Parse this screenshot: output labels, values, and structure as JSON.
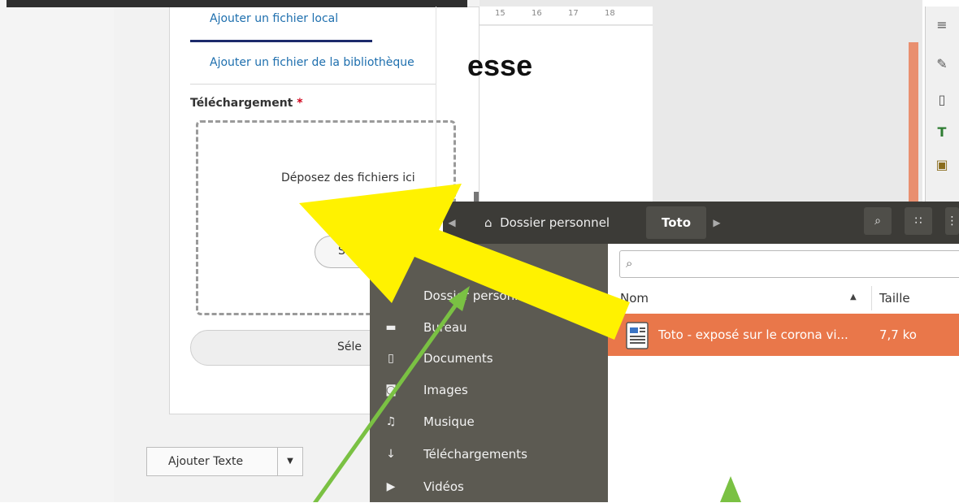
{
  "upload_form": {
    "tab_local": "Ajouter un fichier local",
    "tab_library": "Ajouter un fichier de la bibliothèque",
    "upload_label": "Téléchargement",
    "required_mark": "*",
    "dropzone_text": "Déposez des fichiers ici",
    "select_button_partial": "Se",
    "select_button_wide_partial": "Séle",
    "add_text_label": "Ajouter Texte",
    "add_text_caret": "▼"
  },
  "document": {
    "ruler_labels": [
      "15",
      "16",
      "17",
      "18"
    ],
    "visible_text": "esse"
  },
  "file_dialog": {
    "breadcrumb_home": "Dossier personnel",
    "breadcrumb_current": "Toto",
    "places": [
      {
        "label": "Dossier personnel",
        "icon": "home-icon",
        "glyph": "⌂"
      },
      {
        "label": "Bureau",
        "icon": "folder-icon",
        "glyph": "▬"
      },
      {
        "label": "Documents",
        "icon": "document-icon",
        "glyph": "▯"
      },
      {
        "label": "Images",
        "icon": "camera-icon",
        "glyph": "◙"
      },
      {
        "label": "Musique",
        "icon": "music-icon",
        "glyph": "♫"
      },
      {
        "label": "Téléchargements",
        "icon": "download-icon",
        "glyph": "↓"
      },
      {
        "label": "Vidéos",
        "icon": "video-icon",
        "glyph": "▶"
      }
    ],
    "column_name": "Nom",
    "column_size": "Taille",
    "files": [
      {
        "name": "Toto - exposé sur le corona vi...",
        "size": "7,7 ko"
      }
    ]
  },
  "colors": {
    "selection": "#e9774a",
    "sidebar": "#5c5a52",
    "header": "#3c3b37",
    "yellow_arrow": "#fff200",
    "green_arrow": "#7ac143"
  }
}
